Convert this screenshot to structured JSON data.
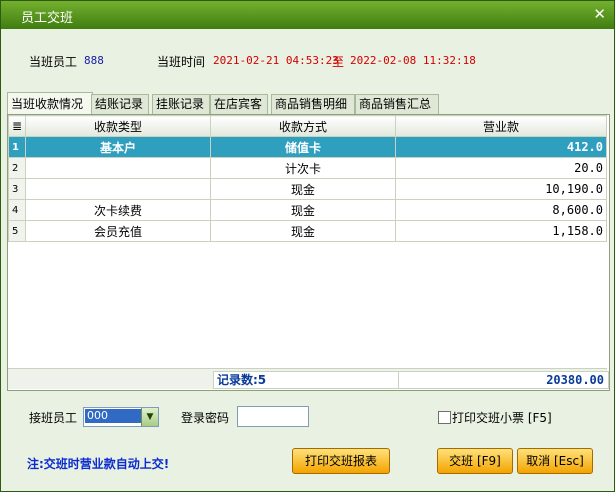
{
  "window": {
    "title": "员工交班"
  },
  "info": {
    "staff_label": "当班员工",
    "staff_value": "888",
    "time_label": "当班时间",
    "start_time": "2021-02-21 04:53:23",
    "to": "至",
    "end_time": "2022-02-08 11:32:18"
  },
  "tabs": [
    {
      "label": "当班收款情况"
    },
    {
      "label": "结账记录"
    },
    {
      "label": "挂账记录"
    },
    {
      "label": "在店宾客"
    },
    {
      "label": "商品销售明细"
    },
    {
      "label": "商品销售汇总"
    }
  ],
  "table": {
    "headers": [
      "收款类型",
      "收款方式",
      "营业款"
    ],
    "rows": [
      {
        "idx": "1",
        "type": "基本户",
        "method": "储值卡",
        "amount": "412.0"
      },
      {
        "idx": "2",
        "type": "",
        "method": "计次卡",
        "amount": "20.0"
      },
      {
        "idx": "3",
        "type": "",
        "method": "现金",
        "amount": "10,190.0"
      },
      {
        "idx": "4",
        "type": "次卡续费",
        "method": "现金",
        "amount": "8,600.0"
      },
      {
        "idx": "5",
        "type": "会员充值",
        "method": "现金",
        "amount": "1,158.0"
      }
    ],
    "record_count": "记录数:5",
    "total": "20380.00"
  },
  "form": {
    "handover_label": "接班员工",
    "handover_value": "000",
    "password_label": "登录密码",
    "print_ticket_label": "打印交班小票 [F5]"
  },
  "note": "注:交班时营业款自动上交!",
  "buttons": {
    "print_report": "打印交班报表",
    "handover": "交班 [F9]",
    "cancel": "取消 [Esc]"
  },
  "colors": {
    "title_bar": "#4f8f1c",
    "selected_row": "#2f9fc0",
    "time_text": "#d40000",
    "accent_blue": "#0a2ad0",
    "button_orange": "#f3a400"
  }
}
